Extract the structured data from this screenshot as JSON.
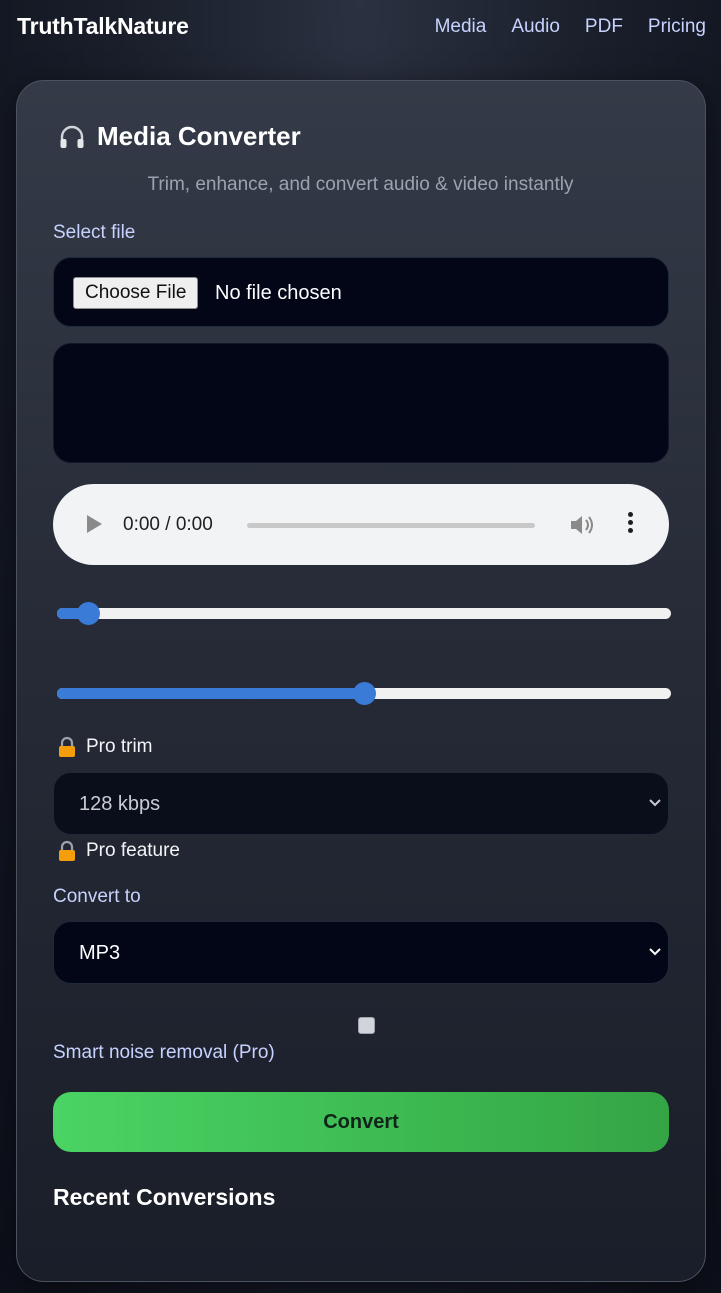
{
  "app": {
    "brand": "TruthTalkNature"
  },
  "nav": {
    "items": [
      "Media",
      "Audio",
      "PDF",
      "Pricing"
    ]
  },
  "converter": {
    "title": "Media Converter",
    "title_icon": "headphones-icon",
    "subtitle": "Trim, enhance, and convert audio & video instantly",
    "select_file_label": "Select file",
    "file_button_label": "Choose File",
    "file_status": "No file chosen",
    "audio_player": {
      "time": "0:00 / 0:00",
      "icons": [
        "play-icon",
        "volume-icon",
        "more-options-icon"
      ]
    },
    "trim_start": 0.05,
    "trim_end": 0.5,
    "pro_trim_label": "Pro trim",
    "bitrate_selected": "128 kbps",
    "pro_feature_label": "Pro feature",
    "lock_icon": "lock-icon",
    "convert_to_label": "Convert to",
    "format_selected": "MP3",
    "noise_removal_label": "Smart noise removal (Pro)",
    "noise_removal_checked": false,
    "convert_button_label": "Convert",
    "recent_heading": "Recent Conversions"
  },
  "colors": {
    "accent": "#3b7bd8",
    "button_green": "#4ad464",
    "lock_orange": "#f59e0b"
  }
}
